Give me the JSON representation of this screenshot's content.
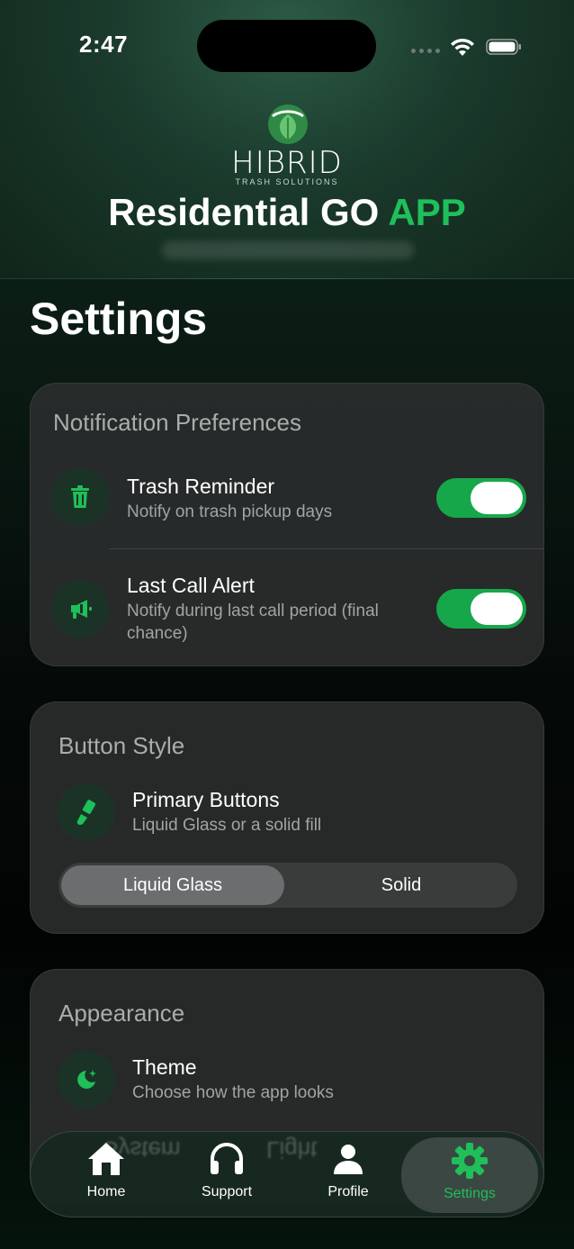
{
  "status_bar": {
    "time": "2:47"
  },
  "header": {
    "logo_text": "HIBRID",
    "logo_subtext": "TRASH SOLUTIONS",
    "app_title_main": "Residential GO ",
    "app_title_accent": "APP"
  },
  "page": {
    "title": "Settings"
  },
  "notifications": {
    "title": "Notification Preferences",
    "items": [
      {
        "title": "Trash Reminder",
        "subtitle": "Notify on trash pickup days",
        "enabled": true
      },
      {
        "title": "Last Call Alert",
        "subtitle": "Notify during last call period (final chance)",
        "enabled": true
      }
    ]
  },
  "button_style": {
    "title": "Button Style",
    "item_title": "Primary Buttons",
    "item_subtitle": "Liquid Glass or a solid fill",
    "options": [
      "Liquid Glass",
      "Solid"
    ],
    "selected": "Liquid Glass"
  },
  "appearance": {
    "title": "Appearance",
    "item_title": "Theme",
    "item_subtitle": "Choose how the app looks",
    "options": [
      "System",
      "Light"
    ]
  },
  "tab_bar": {
    "tabs": [
      {
        "label": "Home",
        "icon": "home-icon"
      },
      {
        "label": "Support",
        "icon": "headphones-icon"
      },
      {
        "label": "Profile",
        "icon": "person-icon"
      },
      {
        "label": "Settings",
        "icon": "gear-icon"
      }
    ],
    "active": "Settings"
  },
  "colors": {
    "accent": "#1fbf5a",
    "toggle_on": "#17a74b",
    "card_bg": "#2a2c2c"
  }
}
